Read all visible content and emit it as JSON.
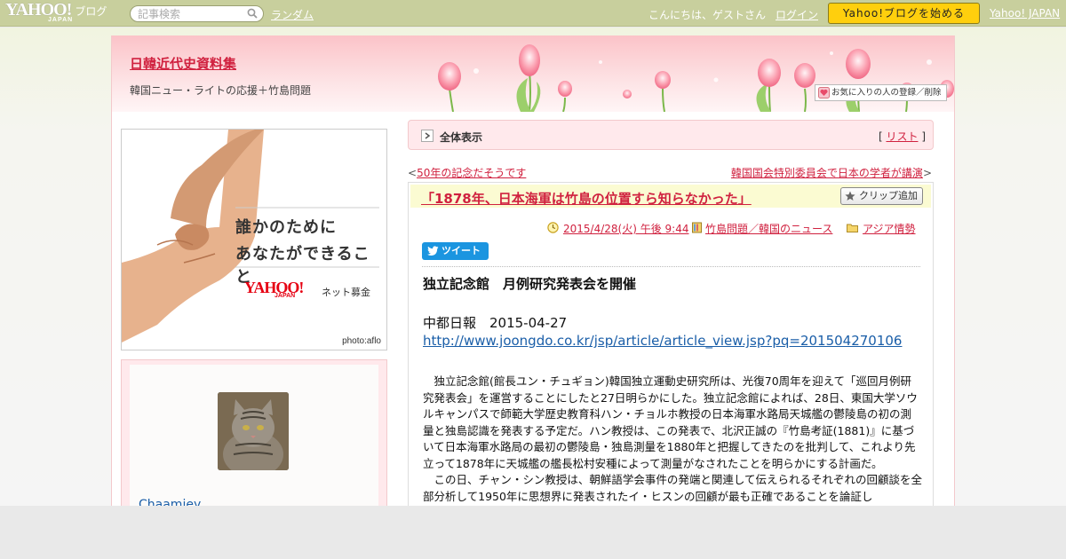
{
  "topbar": {
    "logo_main": "YAHOO!",
    "logo_sub": "JAPAN",
    "logo_blog": "ブログ",
    "search_placeholder": "記事検索",
    "random_link": "ランダム",
    "greeting": "こんにちは、ゲストさん",
    "login_link": "ログイン",
    "start_button": "Yahoo!ブログを始める",
    "yahoo_japan_link": "Yahoo! JAPAN"
  },
  "header": {
    "blog_title": "日韓近代史資料集",
    "blog_description": "韓国ニュー・ライトの応援＋竹島問題",
    "favorite_button": "お気に入りの人の登録／削除"
  },
  "sidebar": {
    "banner": {
      "line1": "誰かのために",
      "line2": "あなたができること",
      "logo_main": "YAHOO!",
      "logo_sub": "JAPAN",
      "donate_label": "ネット募金",
      "photo_credit": "photo:aflo"
    },
    "profile": {
      "name": "Chaamiey"
    }
  },
  "main": {
    "category_bar": {
      "title": "全体表示",
      "list_open": "[",
      "list_link": "リスト",
      "list_close": "]"
    },
    "nav": {
      "prev_arrow": "<",
      "prev_link": "50年の記念だそうです",
      "next_link": "韓国国会特別委員会で日本の学者が講演",
      "next_arrow": ">"
    },
    "article": {
      "title": "「1878年、日本海軍は竹島の位置すら知らなかった」",
      "clip_button": "クリップ追加",
      "date": "2015/4/28(火) 午後 9:44",
      "category": "竹島問題／韓国のニュース",
      "folder": "アジア情勢",
      "tweet_button": "ツイート",
      "heading": "独立記念館　月例研究発表会を開催",
      "source": "中都日報　2015-04-27",
      "link": "http://www.joongdo.co.kr/jsp/article/article_view.jsp?pq=201504270106",
      "paragraph1": "独立記念館(館長ユン・チュギョン)韓国独立運動史研究所は、光復70周年を迎えて「巡回月例研究発表会」を運営することにしたと27日明らかにした。独立記念館によれば、28日、東国大学ソウルキャンパスで師範大学歴史教育科ハン・チョルホ教授の日本海軍水路局天城艦の鬱陵島の初の測量と独島認識を発表する予定だ。ハン教授は、この発表で、北沢正誠の『竹島考証(1881)』に基づいて日本海軍水路局の最初の鬱陵島・独島測量を1880年と把握してきたのを批判して、これより先立って1878年に天城艦の艦長松村安種によって測量がなされたことを明らかにする計画だ。",
      "paragraph2": "この日、チャン・シン教授は、朝鮮語学会事件の発端と関連して伝えられるそれぞれの回顧談を全部分析して1950年に思想界に発表されたイ・ヒスンの回顧が最も正確であることを論証し"
    }
  }
}
